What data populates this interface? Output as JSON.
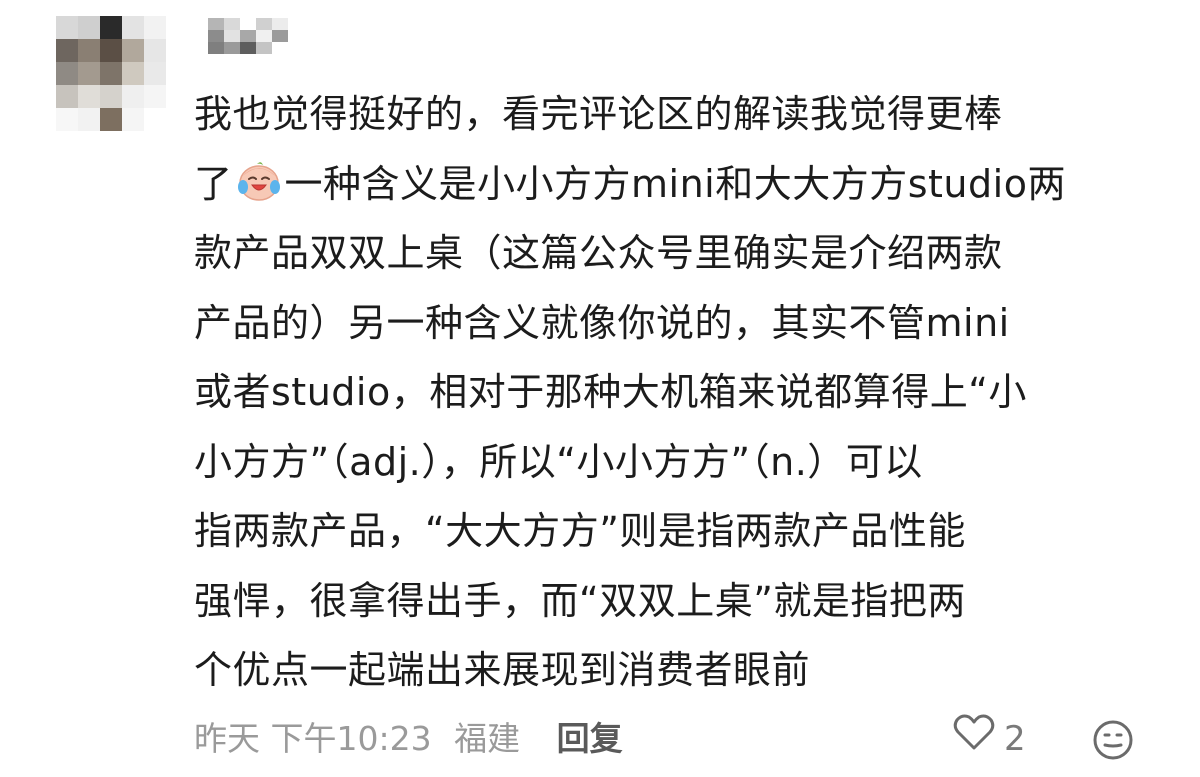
{
  "avatar": {
    "pixels": [
      "#d8d8d8",
      "#cfcfcf",
      "#2a2a2a",
      "#e3e3e3",
      "#f2f2f2",
      "#6e665f",
      "#8a7f73",
      "#5b4f45",
      "#b1a89c",
      "#e6e6e6",
      "#8f8a84",
      "#a39a8f",
      "#7e7469",
      "#cfc9bf",
      "#e9e9e9",
      "#c7c3bd",
      "#e0ddd8",
      "#d5d2cc",
      "#efefef",
      "#f5f5f5",
      "#f7f7f7",
      "#f2f2f2",
      "#7d6f60",
      "#f5f5f5",
      "#ffffff"
    ]
  },
  "username": {
    "pixels": [
      "#b5b5b5",
      "#d9d9d9",
      "#ffffff",
      "#d0d0d0",
      "#ececec",
      "#8c8c8c",
      "#e2e2e2",
      "#a8a8a8",
      "#f0f0f0",
      "#9b9b9b",
      "#7f7f7f",
      "#9a9a9a",
      "#5e5e5e",
      "#c4c4c4",
      "#ffffff"
    ]
  },
  "comment": {
    "line1": "我也觉得挺好的，看完评论区的解读我觉得更棒",
    "line2_before_emoji": "了",
    "line2_after_emoji": "一种含义是小小方方mini和大大方方studio两",
    "line3": "款产品双双上桌（这篇公众号里确实是介绍两款",
    "line4": "产品的）另一种含义就像你说的，其实不管mini",
    "line5": "或者studio，相对于那种大机箱来说都算得上“小",
    "line6": "小方方”（adj.），所以“小小方方”（n.）可以",
    "line7": "指两款产品，“大大方方”则是指两款产品性能",
    "line8": "强悍，很拿得出手，而“双双上桌”就是指把两",
    "line9": "个优点一起端出来展现到消费者眼前",
    "emoji_icon": "crying-laughing-face-icon"
  },
  "footer": {
    "time": "昨天 下午10:23",
    "location": "福建",
    "reply_label": "回复",
    "like_count": "2",
    "like_icon": "heart-outline-icon",
    "reaction_icon": "smiley-face-icon"
  }
}
